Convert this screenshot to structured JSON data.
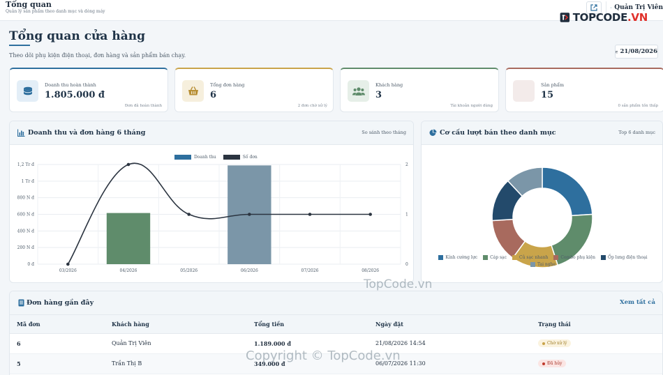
{
  "topbar": {
    "title": "Tổng quan",
    "subtitle": "Quản lý sản phẩm theo danh mục và dòng máy",
    "user_name": "Quản Trị Viên"
  },
  "logo": {
    "text_main": "TOPCODE",
    "text_accent": ".VN"
  },
  "header": {
    "title": "Tổng quan cửa hàng",
    "description": "Theo dõi phụ kiện điện thoại, đơn hàng và sản phẩm bán chạy.",
    "date": "21/08/2026"
  },
  "stats": [
    {
      "label": "Doanh thu hoàn thành",
      "value": "1.805.000 đ",
      "note": "Đơn đã hoàn thành",
      "icon": "coins-icon",
      "accent": "#2e6f9e",
      "bg": "#e3eef7"
    },
    {
      "label": "Tổng đơn hàng",
      "value": "6",
      "note": "2 đơn chờ xử lý",
      "icon": "basket-icon",
      "accent": "#c9a44a",
      "bg": "#f6efdd"
    },
    {
      "label": "Khách hàng",
      "value": "3",
      "note": "Tài khoản người dùng",
      "icon": "users-icon",
      "accent": "#5f8c6b",
      "bg": "#e6efe8"
    },
    {
      "label": "Sản phẩm",
      "value": "15",
      "note": "0 sản phẩm tồn thấp",
      "icon": "box-icon",
      "accent": "#a86a5e",
      "bg": "#f3ebea"
    }
  ],
  "revenue_panel": {
    "title": "Doanh thu và đơn hàng 6 tháng",
    "right_label": "So sánh theo tháng"
  },
  "donut_panel": {
    "title": "Cơ cấu lượt bán theo danh mục",
    "right_label": "Top 6 danh mục"
  },
  "chart_data": [
    {
      "type": "bar",
      "categories": [
        "03/2026",
        "04/2026",
        "05/2026",
        "06/2026",
        "07/2026",
        "08/2026"
      ],
      "series": [
        {
          "name": "Doanh thu",
          "type": "bar",
          "values": [
            0,
            616000,
            0,
            1189000,
            0,
            0
          ],
          "color": "#5f8c6b",
          "colors": [
            "#5f8c6b",
            "#5f8c6b",
            "#5f8c6b",
            "#7b96a8",
            "#7b96a8",
            "#7b96a8"
          ]
        },
        {
          "name": "Số đơn",
          "type": "line",
          "values": [
            0,
            2,
            1,
            1,
            1,
            1
          ],
          "color": "#2b3440"
        }
      ],
      "y_left": {
        "min": 0,
        "max": 1200000,
        "ticks": [
          "0 đ",
          "200 N đ",
          "400 N đ",
          "600 N đ",
          "800 N đ",
          "1 Tr đ",
          "1,2 Tr đ"
        ]
      },
      "y_right": {
        "min": 0,
        "max": 2,
        "ticks": [
          "0",
          "1",
          "2"
        ]
      },
      "legend": [
        {
          "name": "Doanh thu",
          "color": "#2e6f9e"
        },
        {
          "name": "Số đơn",
          "color": "#2b3440"
        }
      ],
      "legend_position": "top"
    },
    {
      "type": "pie",
      "donut": true,
      "categories": [
        "Kính cường lực",
        "Cáp sạc",
        "Củ sạc nhanh",
        "Combo phụ kiện",
        "Ốp lưng điện thoại",
        "Tai nghe"
      ],
      "values": [
        24,
        21,
        15,
        14,
        14,
        12
      ],
      "colors": [
        "#2e6f9e",
        "#5f8c6b",
        "#c9a44a",
        "#a86a5e",
        "#234a6b",
        "#7b96a8"
      ],
      "legend_position": "bottom"
    }
  ],
  "orders": {
    "title": "Đơn hàng gần đây",
    "view_all": "Xem tất cả",
    "columns": [
      "Mã đơn",
      "Khách hàng",
      "Tổng tiền",
      "Ngày đặt",
      "Trạng thái"
    ],
    "rows": [
      {
        "id": "6",
        "customer": "Quản Trị Viên",
        "total": "1.189.000 đ",
        "date": "21/08/2026 14:54",
        "status": "Chờ xử lý",
        "status_color": "#c9a44a",
        "status_bg": "#fbf3df"
      },
      {
        "id": "5",
        "customer": "Trần Thị B",
        "total": "349.000 đ",
        "date": "06/07/2026 11:30",
        "status": "Đã hủy",
        "status_color": "#c0392b",
        "status_bg": "#fbe5e3"
      }
    ]
  },
  "watermarks": [
    "TopCode.vn",
    "Copyright © TopCode.vn"
  ]
}
